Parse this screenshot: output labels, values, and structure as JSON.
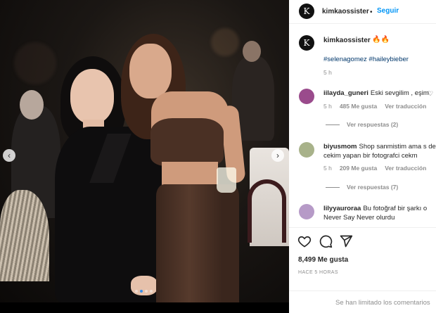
{
  "post": {
    "username": "kimkaossister",
    "follow_separator": "•",
    "follow_label": "Seguir",
    "more_icon": "more-options-icon",
    "caption_emoji": "🔥🔥",
    "hashtags": "#selenagomez #haileybieber",
    "caption_time": "5 h",
    "likes": "8,499 Me gusta",
    "posted_ago": "HACE 5 HORAS",
    "comments_limited": "Se han limitado los comentarios",
    "carousel_total": 4,
    "carousel_active": 2
  },
  "comments": [
    {
      "username": "iilayda_guneri",
      "text": "Eski sevgilim , eşim",
      "time": "5 h",
      "likes": "485 Me gusta",
      "reply_label": "Ver traducción",
      "replies": "Ver respuestas (2)",
      "avatar_color": "#9a4b8c"
    },
    {
      "username": "biyusmom",
      "text": "Shop sanmistim ama s de cekim yapan bir fotografci cekm",
      "time": "5 h",
      "likes": "209 Me gusta",
      "reply_label": "Ver traducción",
      "replies": "Ver respuestas (7)",
      "avatar_color": "#a8b28a"
    },
    {
      "username": "lilyyauroraa",
      "text": "Bu fotoğraf bir şarkı o Never Say Never olurdu",
      "avatar_color": "#b69ac7"
    }
  ],
  "icons": {
    "like": "heart-icon",
    "comment": "comment-icon",
    "share": "share-icon",
    "prev": "chevron-left-icon",
    "next": "chevron-right-icon"
  },
  "colors": {
    "link": "#0095f6",
    "hashtag": "#00376b",
    "muted": "#8e8e8e",
    "text": "#262626"
  }
}
